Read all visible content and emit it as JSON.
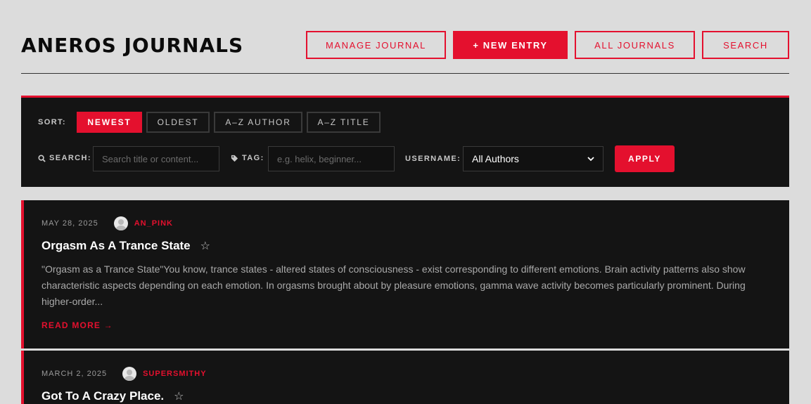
{
  "header": {
    "title": "ANEROS JOURNALS",
    "buttons": {
      "manage": "MANAGE JOURNAL",
      "new_entry": "+ NEW ENTRY",
      "all": "ALL JOURNALS",
      "search": "SEARCH"
    }
  },
  "filters": {
    "sort_label": "SORT:",
    "sort_options": [
      "NEWEST",
      "OLDEST",
      "A–Z AUTHOR",
      "A–Z TITLE"
    ],
    "active_sort": "NEWEST",
    "search_label": "SEARCH:",
    "search_placeholder": "Search title or content...",
    "tag_label": "TAG:",
    "tag_placeholder": "e.g. helix, beginner...",
    "username_label": "USERNAME:",
    "username_selected": "All Authors",
    "apply": "APPLY"
  },
  "entries": [
    {
      "date": "MAY 28, 2025",
      "author": "AN_PINK",
      "title": "Orgasm As A Trance State",
      "excerpt": "\"Orgasm as a Trance State\"You know, trance states - altered states of consciousness - exist corresponding to different emotions. Brain activity patterns also show characteristic aspects depending on each emotion. In orgasms brought about by pleasure emotions, gamma wave activity becomes particularly prominent. During higher-order...",
      "read_more": "READ MORE →"
    },
    {
      "date": "MARCH 2, 2025",
      "author": "SUPERSMITHY",
      "title": "Got To A Crazy Place."
    }
  ],
  "colors": {
    "accent": "#e4102e",
    "panel": "#141414",
    "page": "#dcdcdc"
  }
}
